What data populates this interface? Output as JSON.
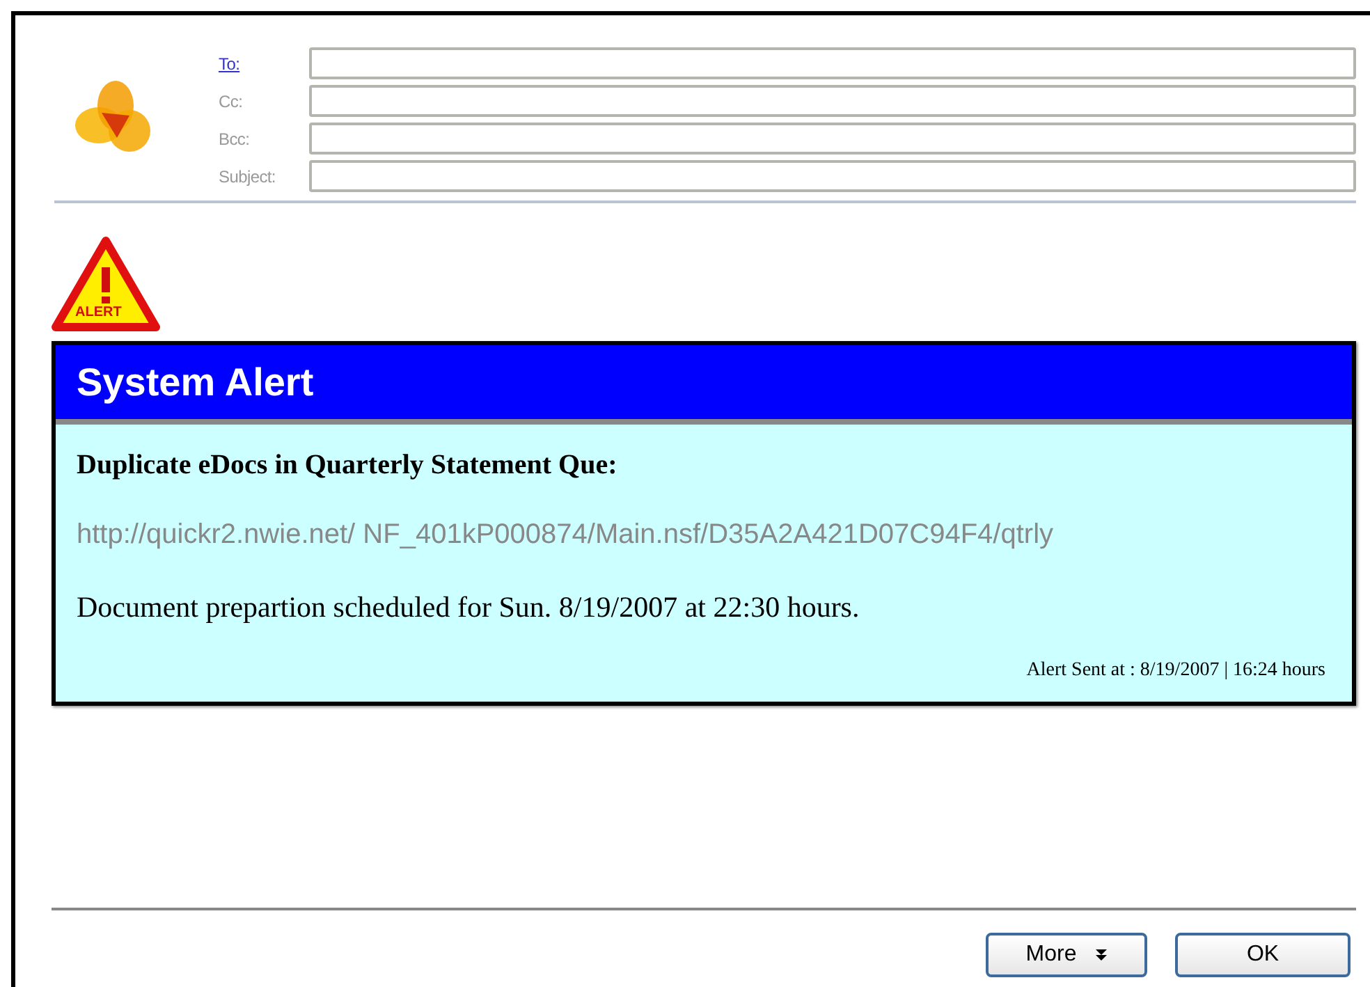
{
  "header_fields": [
    {
      "label": "To:",
      "kind": "link"
    },
    {
      "label": "Cc:",
      "kind": "plain"
    },
    {
      "label": "Bcc:",
      "kind": "plain"
    },
    {
      "label": "Subject:",
      "kind": "plain"
    }
  ],
  "alert": {
    "icon_label": "ALERT",
    "title": "System Alert",
    "heading": "Duplicate eDocs in Quarterly Statement Que:",
    "link": "http://quickr2.nwie.net/ NF_401kP000874/Main.nsf/D35A2A421D07C94F4/qtrly",
    "message": "Document prepartion scheduled for Sun. 8/19/2007 at 22:30 hours.",
    "sent": "Alert Sent at : 8/19/2007 | 16:24 hours"
  },
  "buttons": [
    {
      "label": "More",
      "kind": "menu"
    },
    {
      "label": "OK",
      "kind": "plain"
    }
  ]
}
